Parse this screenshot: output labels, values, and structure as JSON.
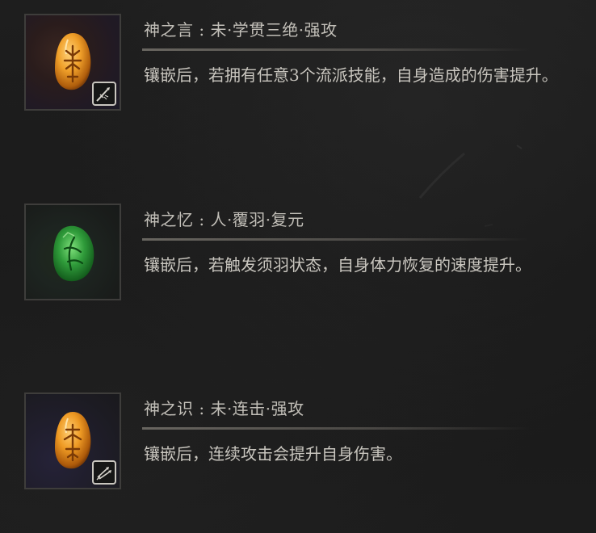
{
  "runes": [
    {
      "title": "神之言 : 未·学贯三绝·强攻",
      "description": "镶嵌后，若拥有任意3个流派技能，自身造成的伤害提升。",
      "gem_color": "amber",
      "badge_icon": "sword-strike-icon"
    },
    {
      "title": "神之忆 : 人·覆羽·复元",
      "description": "镶嵌后，若触发须羽状态，自身体力恢复的速度提升。",
      "gem_color": "emerald",
      "badge_icon": null
    },
    {
      "title": "神之识 : 未·连击·强攻",
      "description": "镶嵌后，连续攻击会提升自身伤害。",
      "gem_color": "amber",
      "badge_icon": "combo-strike-icon"
    }
  ],
  "colors": {
    "background": "#1b1b1b",
    "text": "#c9c6bf",
    "amber_gem": "#e8931c",
    "emerald_gem": "#2f9b3a"
  }
}
